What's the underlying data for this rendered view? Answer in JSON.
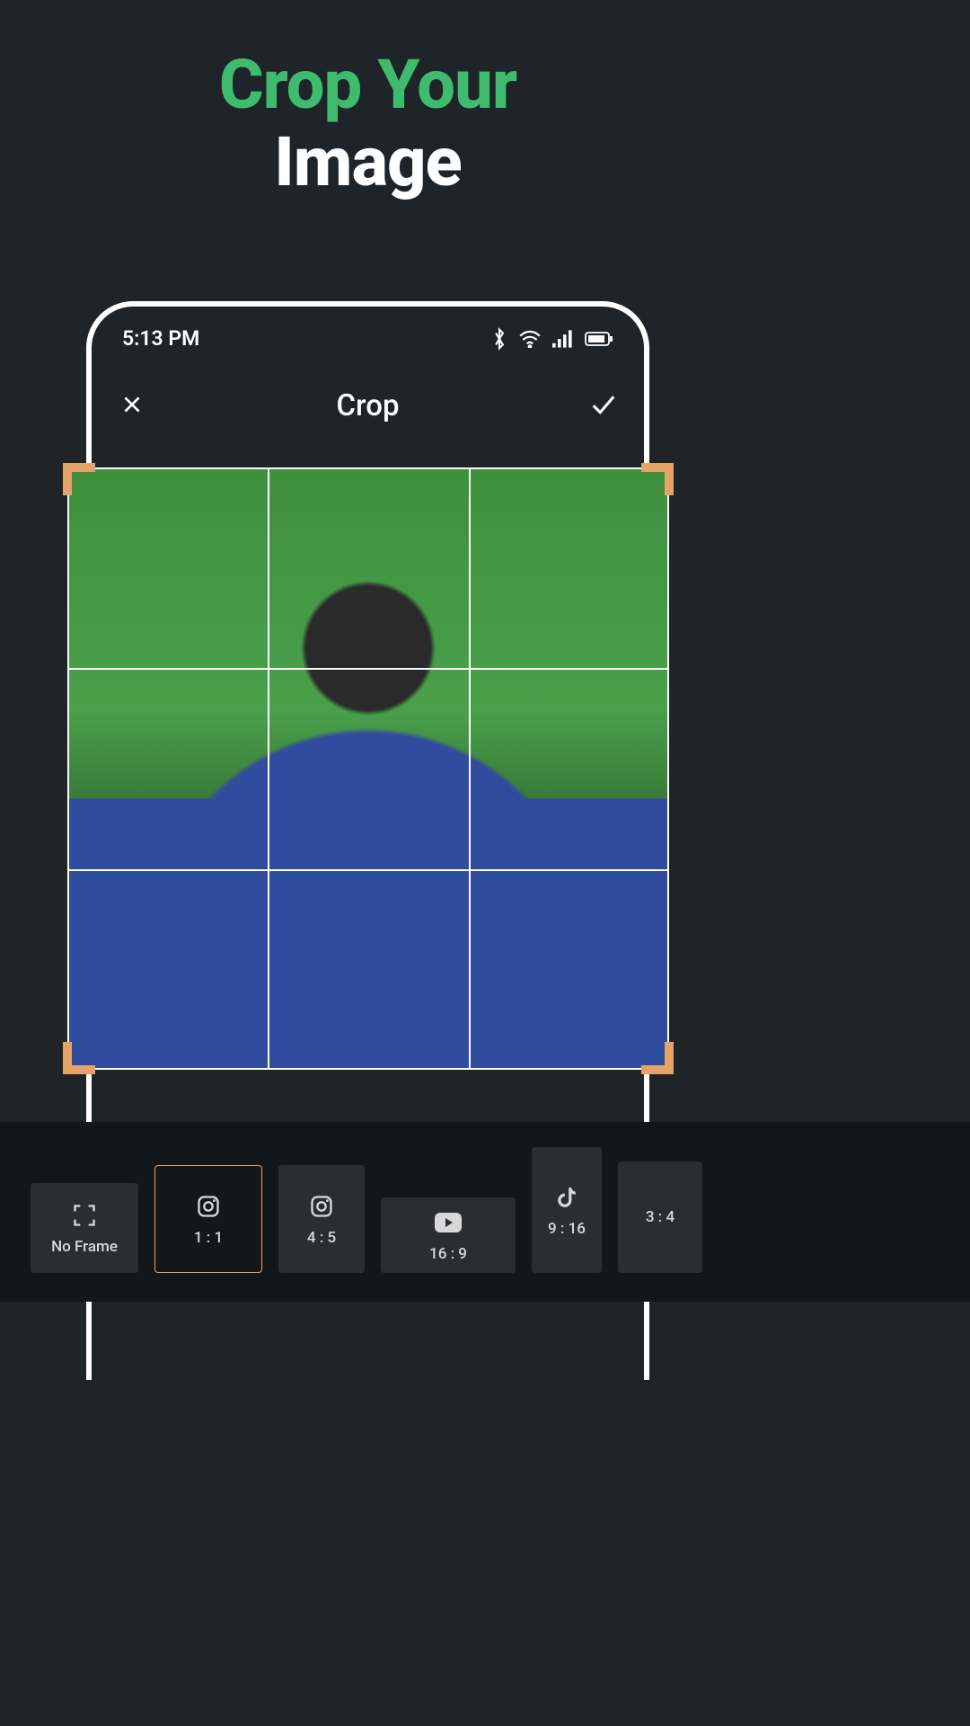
{
  "promo": {
    "line1": "Crop Your",
    "line2": "Image"
  },
  "statusbar": {
    "time": "5:13 PM"
  },
  "header": {
    "title": "Crop"
  },
  "ratios": {
    "noframe": "No Frame",
    "r1_1": "1 : 1",
    "r4_5": "4 : 5",
    "r16_9": "16 : 9",
    "r9_16": "9 : 16",
    "r3_4": "3 : 4"
  },
  "colors": {
    "accent_green": "#3fbb6d",
    "accent_orange": "#e5a368",
    "bg": "#1e2428"
  }
}
